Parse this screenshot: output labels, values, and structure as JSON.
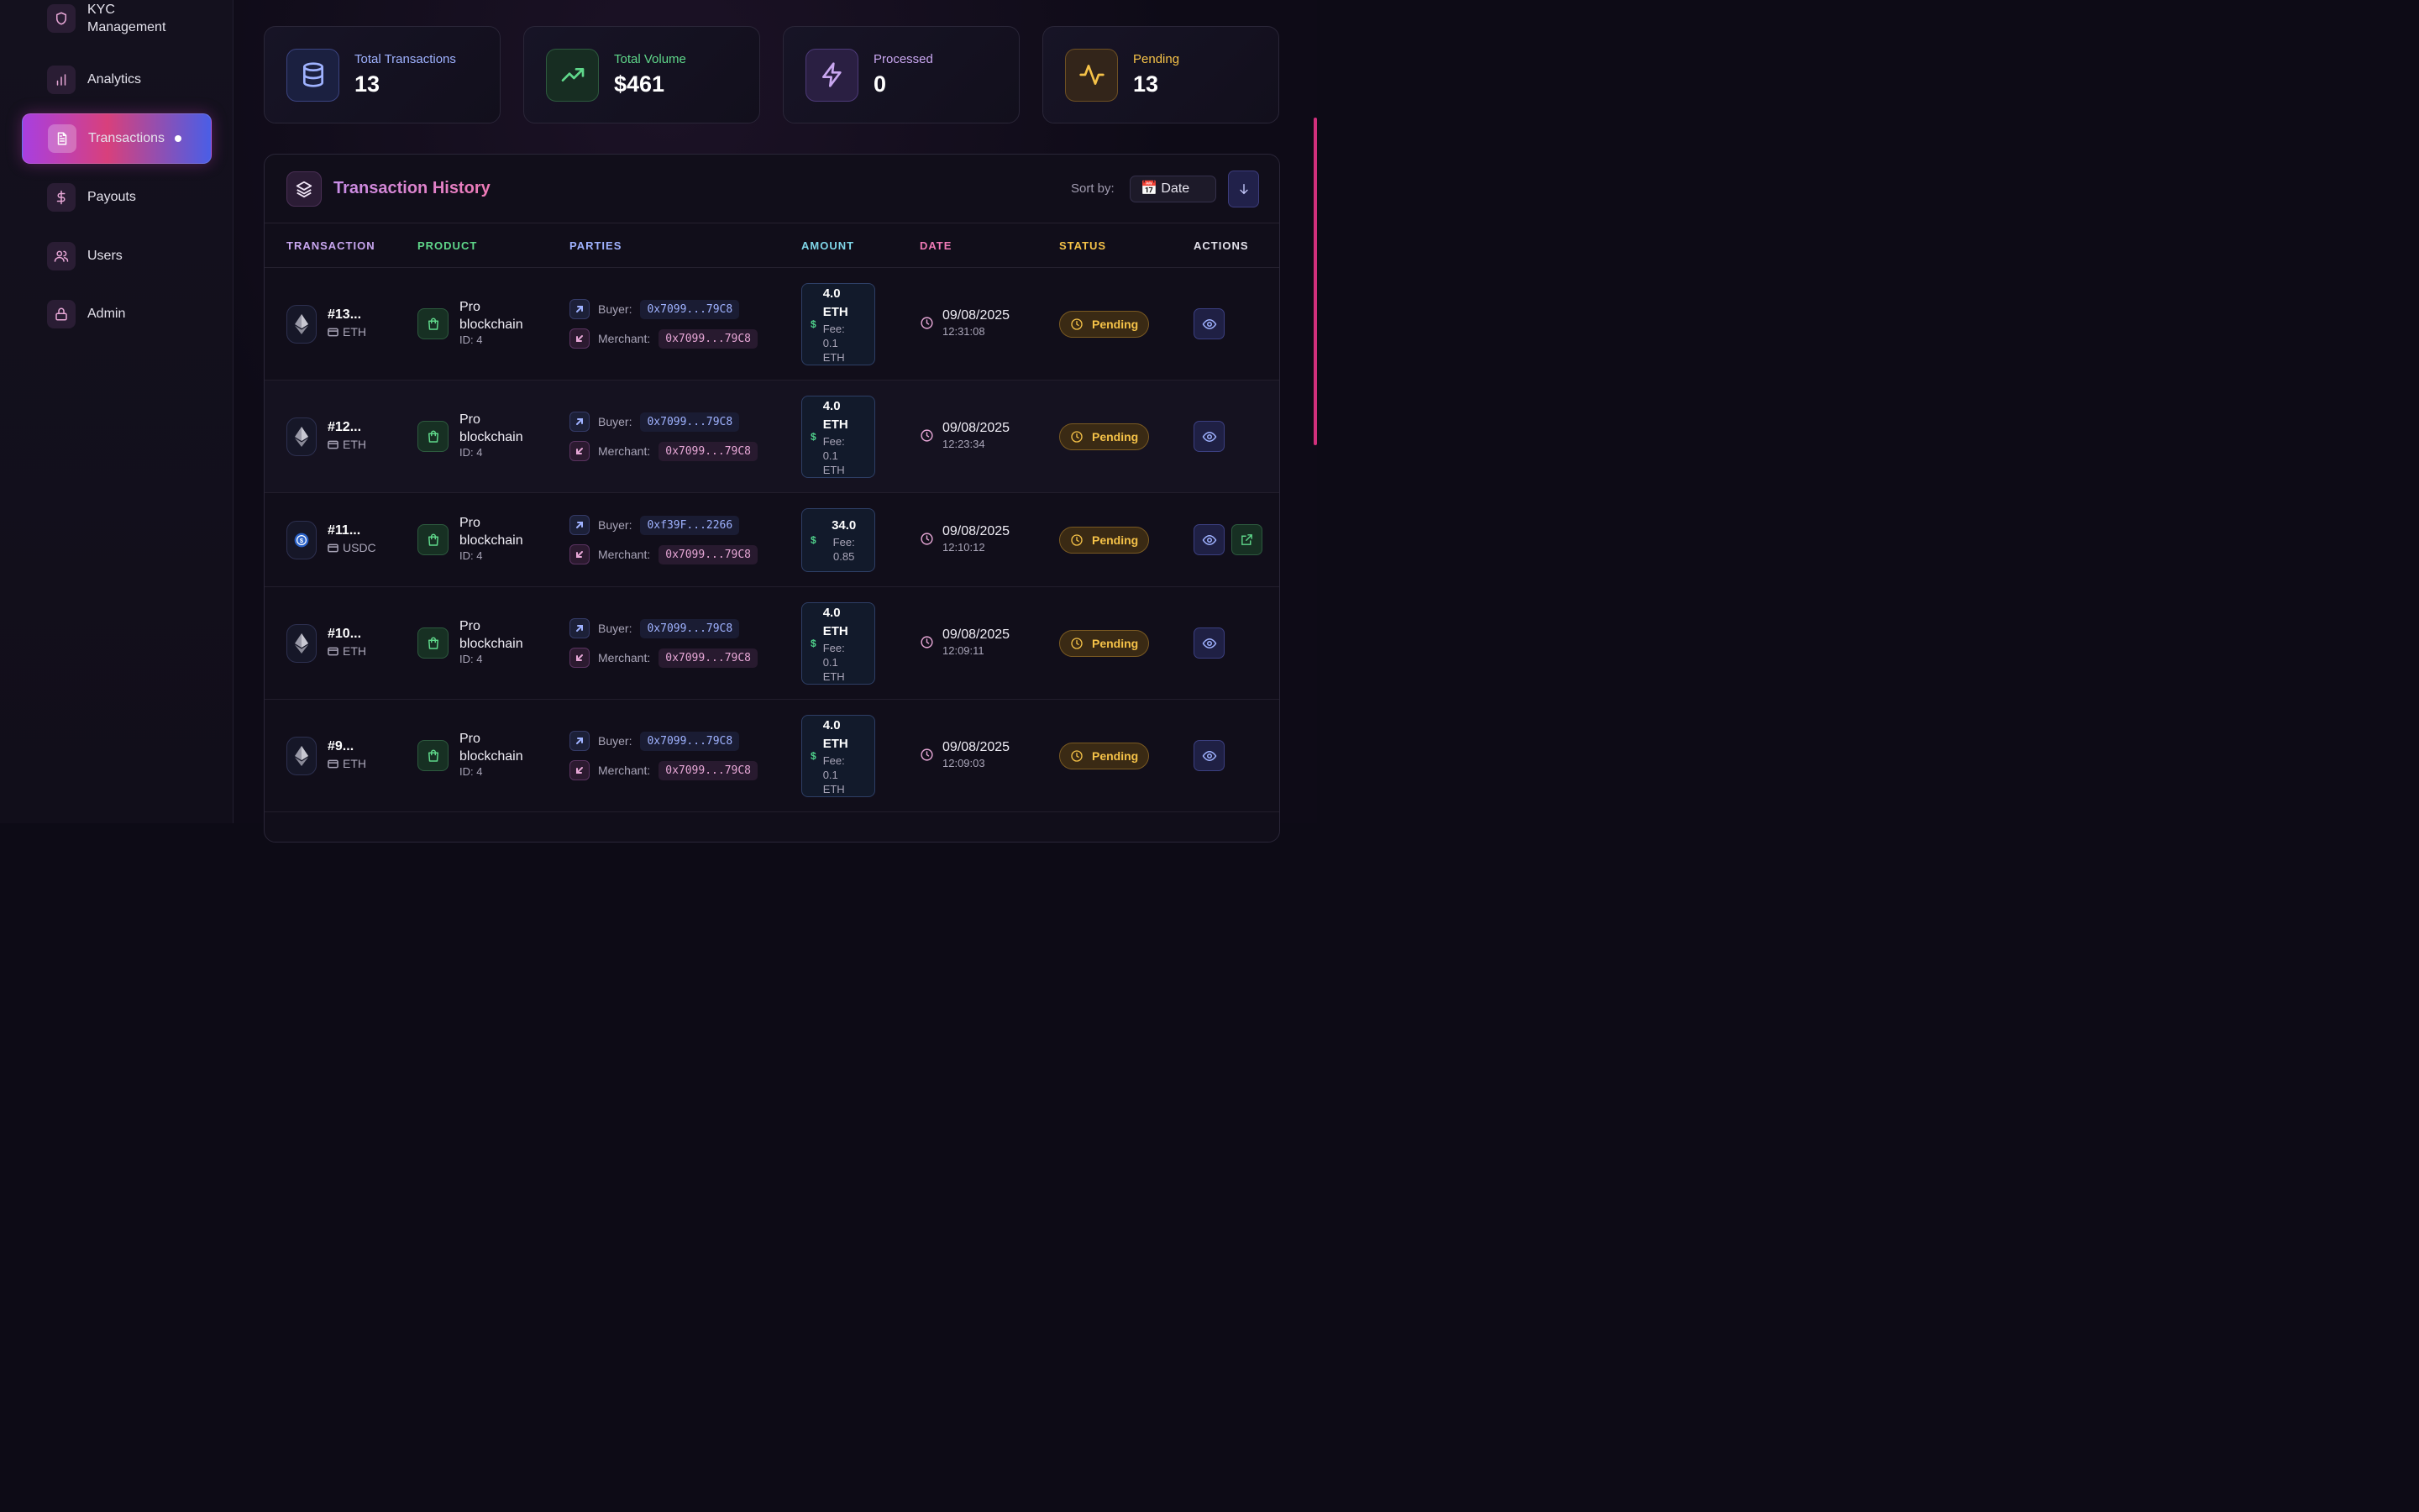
{
  "sidebar": {
    "items": [
      {
        "label": "KYC Management",
        "icon": "shield-icon"
      },
      {
        "label": "Analytics",
        "icon": "bar-chart-icon"
      },
      {
        "label": "Transactions",
        "icon": "file-text-icon",
        "active": true
      },
      {
        "label": "Payouts",
        "icon": "dollar-icon"
      },
      {
        "label": "Users",
        "icon": "users-icon"
      },
      {
        "label": "Admin",
        "icon": "lock-icon"
      }
    ]
  },
  "stats": [
    {
      "label": "Total Transactions",
      "value": "13",
      "icon": "database-icon",
      "color": "#9fb2ff"
    },
    {
      "label": "Total Volume",
      "value": "$461",
      "icon": "trending-up-icon",
      "color": "#5fd78a"
    },
    {
      "label": "Processed",
      "value": "0",
      "icon": "zap-icon",
      "color": "#c9a7f0"
    },
    {
      "label": "Pending",
      "value": "13",
      "icon": "activity-icon",
      "color": "#f5c248"
    }
  ],
  "history": {
    "title": "Transaction History",
    "sort_label": "Sort by:",
    "sort_value": "📅 Date",
    "columns": [
      "TRANSACTION",
      "PRODUCT",
      "PARTIES",
      "AMOUNT",
      "DATE",
      "STATUS",
      "ACTIONS"
    ],
    "buyer_label": "Buyer:",
    "merchant_label": "Merchant:",
    "rows": [
      {
        "id": "#13...",
        "currency": "ETH",
        "product": "Pro blockchain",
        "product_id": "ID: 4",
        "buyer": "0x7099...79C8",
        "merchant": "0x7099...79C8",
        "amount": "4.0 ETH",
        "fee": "Fee: 0.1 ETH",
        "date": "09/08/2025",
        "time": "12:31:08",
        "status": "Pending"
      },
      {
        "id": "#12...",
        "currency": "ETH",
        "product": "Pro blockchain",
        "product_id": "ID: 4",
        "buyer": "0x7099...79C8",
        "merchant": "0x7099...79C8",
        "amount": "4.0 ETH",
        "fee": "Fee: 0.1 ETH",
        "date": "09/08/2025",
        "time": "12:23:34",
        "status": "Pending"
      },
      {
        "id": "#11...",
        "currency": "USDC",
        "product": "Pro blockchain",
        "product_id": "ID: 4",
        "buyer": "0xf39F...2266",
        "merchant": "0x7099...79C8",
        "amount": "34.0",
        "fee": "Fee: 0.85",
        "date": "09/08/2025",
        "time": "12:10:12",
        "status": "Pending"
      },
      {
        "id": "#10...",
        "currency": "ETH",
        "product": "Pro blockchain",
        "product_id": "ID: 4",
        "buyer": "0x7099...79C8",
        "merchant": "0x7099...79C8",
        "amount": "4.0 ETH",
        "fee": "Fee: 0.1 ETH",
        "date": "09/08/2025",
        "time": "12:09:11",
        "status": "Pending"
      },
      {
        "id": "#9...",
        "currency": "ETH",
        "product": "Pro blockchain",
        "product_id": "ID: 4",
        "buyer": "0x7099...79C8",
        "merchant": "0x7099...79C8",
        "amount": "4.0 ETH",
        "fee": "Fee: 0.1 ETH",
        "date": "09/08/2025",
        "time": "12:09:03",
        "status": "Pending"
      }
    ]
  }
}
